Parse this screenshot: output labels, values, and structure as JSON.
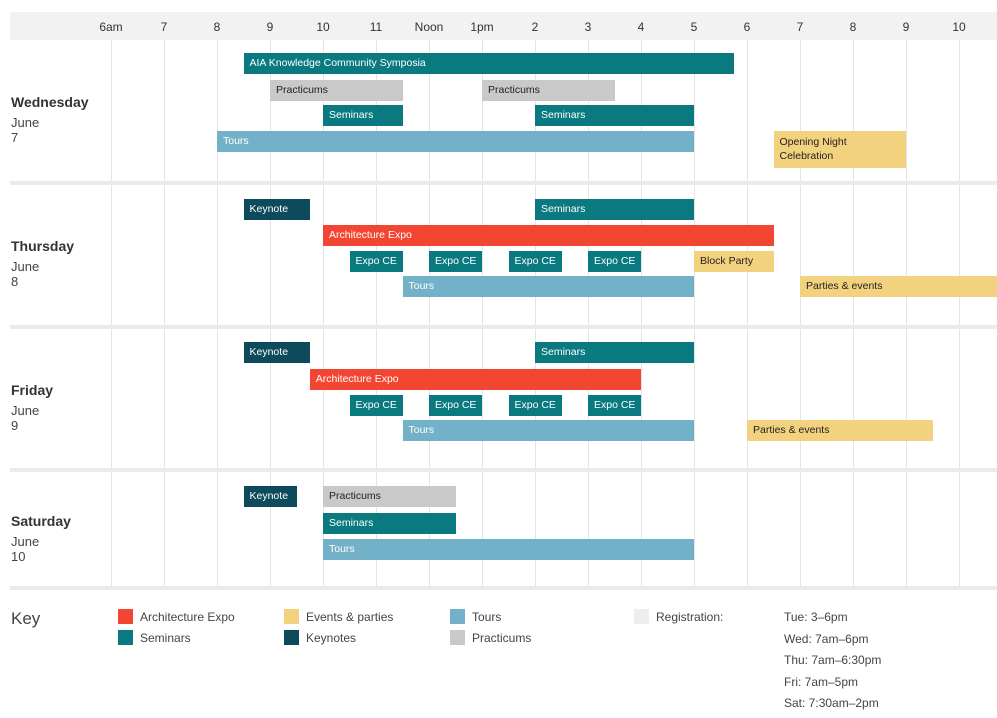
{
  "chart_data": {
    "type": "gantt",
    "hours": [
      "6am",
      "7",
      "8",
      "9",
      "10",
      "11",
      "Noon",
      "1pm",
      "2",
      "3",
      "4",
      "5",
      "6",
      "7",
      "8",
      "9",
      "10"
    ],
    "hour_start": 6,
    "colors": {
      "expo": "#f24632",
      "seminars": "#0a7a80",
      "keynotes": "#0d4a5c",
      "tours": "#72b1c8",
      "practicums": "#c9c9c9",
      "events": "#f3d27f",
      "registration": "#eeeeee"
    },
    "days": [
      {
        "name": "Wednesday",
        "date": "June 7",
        "rows": [
          [
            {
              "label": "AIA Knowledge Community Symposia",
              "cat": "seminars",
              "start": 8.5,
              "end": 17.75
            }
          ],
          [
            {
              "label": "Practicums",
              "cat": "practicums",
              "start": 9,
              "end": 11.5
            },
            {
              "label": "Practicums",
              "cat": "practicums",
              "start": 13,
              "end": 15.5
            }
          ],
          [
            {
              "label": "Seminars",
              "cat": "seminars",
              "start": 10,
              "end": 11.5
            },
            {
              "label": "Seminars",
              "cat": "seminars",
              "start": 14,
              "end": 17
            }
          ],
          [
            {
              "label": "Tours",
              "cat": "tours",
              "start": 8,
              "end": 17
            },
            {
              "label": "Opening Night Celebration",
              "cat": "events",
              "start": 18.5,
              "end": 21,
              "tall": true
            }
          ]
        ]
      },
      {
        "name": "Thursday",
        "date": "June 8",
        "rows": [
          [
            {
              "label": "Keynote",
              "cat": "keynotes",
              "start": 8.5,
              "end": 9.75
            },
            {
              "label": "Seminars",
              "cat": "seminars",
              "start": 14,
              "end": 17
            }
          ],
          [
            {
              "label": "Architecture Expo",
              "cat": "expo",
              "start": 10,
              "end": 18.5
            }
          ],
          [
            {
              "label": "Expo CE",
              "cat": "seminars",
              "start": 10.5,
              "end": 11.5
            },
            {
              "label": "Expo CE",
              "cat": "seminars",
              "start": 12,
              "end": 13
            },
            {
              "label": "Expo CE",
              "cat": "seminars",
              "start": 13.5,
              "end": 14.5
            },
            {
              "label": "Expo CE",
              "cat": "seminars",
              "start": 15,
              "end": 16
            },
            {
              "label": "Block Party",
              "cat": "events",
              "start": 17,
              "end": 18.5
            }
          ],
          [
            {
              "label": "Tours",
              "cat": "tours",
              "start": 11.5,
              "end": 17
            },
            {
              "label": "Parties & events",
              "cat": "events",
              "start": 19,
              "end": 23
            }
          ]
        ]
      },
      {
        "name": "Friday",
        "date": "June 9",
        "rows": [
          [
            {
              "label": "Keynote",
              "cat": "keynotes",
              "start": 8.5,
              "end": 9.75
            },
            {
              "label": "Seminars",
              "cat": "seminars",
              "start": 14,
              "end": 17
            }
          ],
          [
            {
              "label": "Architecture Expo",
              "cat": "expo",
              "start": 9.75,
              "end": 16
            }
          ],
          [
            {
              "label": "Expo CE",
              "cat": "seminars",
              "start": 10.5,
              "end": 11.5
            },
            {
              "label": "Expo CE",
              "cat": "seminars",
              "start": 12,
              "end": 13
            },
            {
              "label": "Expo CE",
              "cat": "seminars",
              "start": 13.5,
              "end": 14.5
            },
            {
              "label": "Expo CE",
              "cat": "seminars",
              "start": 15,
              "end": 16
            }
          ],
          [
            {
              "label": "Tours",
              "cat": "tours",
              "start": 11.5,
              "end": 17
            },
            {
              "label": "Parties & events",
              "cat": "events",
              "start": 18,
              "end": 21.5
            }
          ]
        ]
      },
      {
        "name": "Saturday",
        "date": "June 10",
        "rows": [
          [
            {
              "label": "Keynote",
              "cat": "keynotes",
              "start": 8.5,
              "end": 9.5
            },
            {
              "label": "Practicums",
              "cat": "practicums",
              "start": 10,
              "end": 12.5
            }
          ],
          [
            {
              "label": "Seminars",
              "cat": "seminars",
              "start": 10,
              "end": 12.5
            }
          ],
          [
            {
              "label": "Tours",
              "cat": "tours",
              "start": 10,
              "end": 17
            }
          ]
        ]
      }
    ]
  },
  "key": {
    "title": "Key",
    "items": [
      {
        "label": "Architecture Expo",
        "cat": "expo"
      },
      {
        "label": "Seminars",
        "cat": "seminars"
      },
      {
        "label": "Events & parties",
        "cat": "events"
      },
      {
        "label": "Keynotes",
        "cat": "keynotes"
      },
      {
        "label": "Tours",
        "cat": "tours"
      },
      {
        "label": "Practicums",
        "cat": "practicums"
      }
    ],
    "registration": {
      "label": "Registration:",
      "cat": "registration",
      "times": [
        "Tue: 3–6pm",
        "Wed: 7am–6pm",
        "Thu: 7am–6:30pm",
        "Fri: 7am–5pm",
        "Sat: 7:30am–2pm"
      ]
    }
  }
}
